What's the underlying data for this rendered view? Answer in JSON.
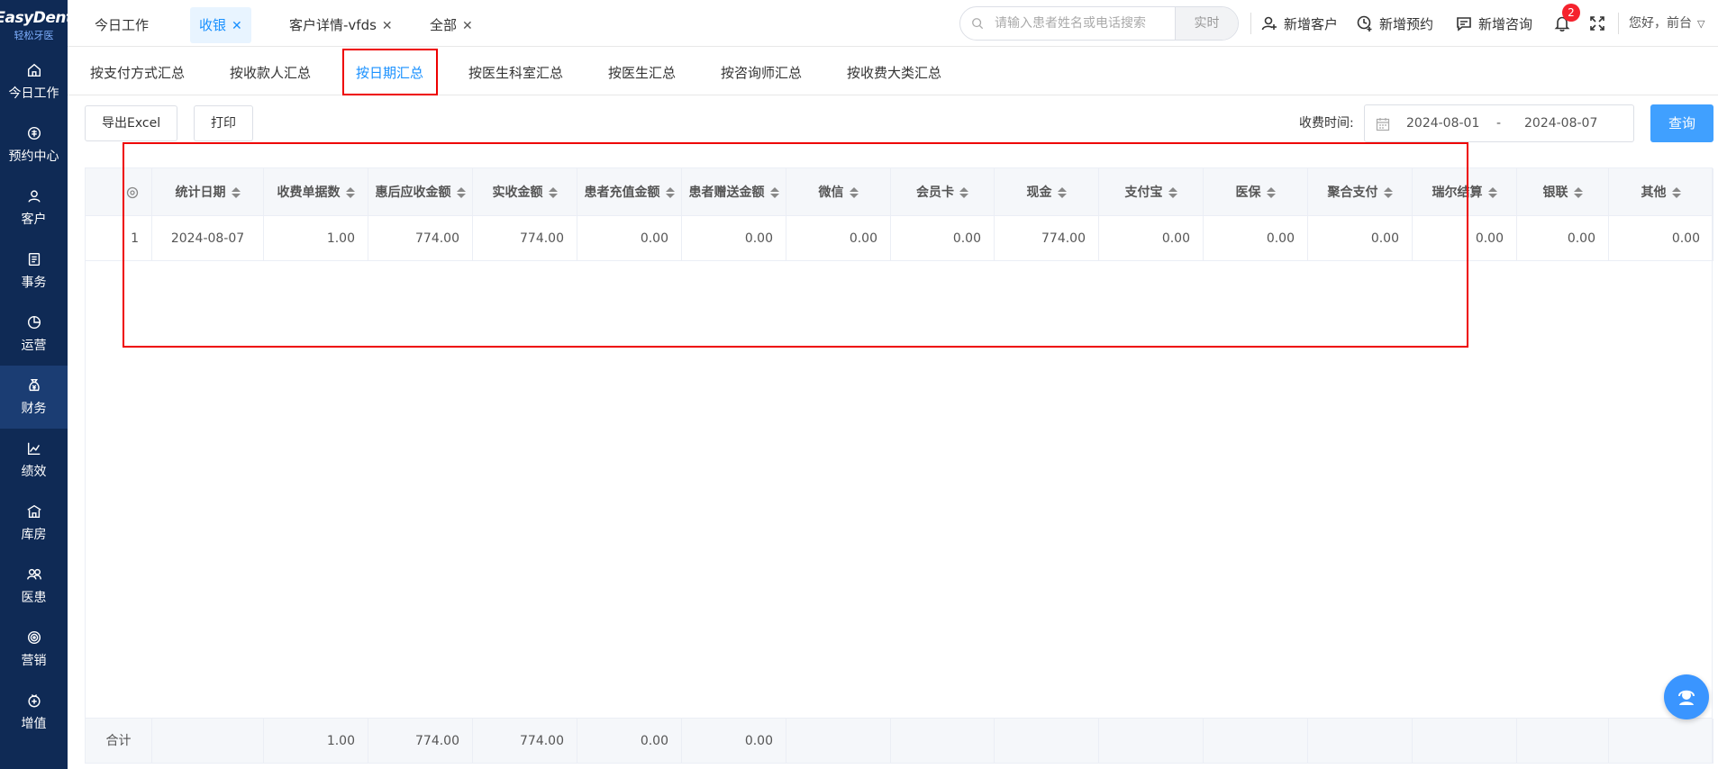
{
  "logo": {
    "line1": "EasyDent",
    "line2": "轻松牙医"
  },
  "sidebar": {
    "items": [
      {
        "label": "今日工作",
        "icon": "home-icon"
      },
      {
        "label": "预约中心",
        "icon": "calendar-icon"
      },
      {
        "label": "客户",
        "icon": "user-icon"
      },
      {
        "label": "事务",
        "icon": "task-icon"
      },
      {
        "label": "运营",
        "icon": "pie-chart-icon"
      },
      {
        "label": "财务",
        "icon": "money-bag-icon"
      },
      {
        "label": "绩效",
        "icon": "line-chart-icon"
      },
      {
        "label": "库房",
        "icon": "warehouse-icon"
      },
      {
        "label": "医患",
        "icon": "doctor-patient-icon"
      },
      {
        "label": "营销",
        "icon": "target-icon"
      },
      {
        "label": "增值",
        "icon": "value-added-icon"
      }
    ],
    "active": "财务"
  },
  "tabs": [
    {
      "label": "今日工作",
      "closable": false
    },
    {
      "label": "收银",
      "closable": true
    },
    {
      "label": "客户详情-vfds",
      "closable": true
    },
    {
      "label": "全部",
      "closable": true
    }
  ],
  "search": {
    "placeholder": "请输入患者姓名或电话搜索",
    "mode": "实时"
  },
  "actions": {
    "new_customer": "新增客户",
    "new_appointment": "新增预约",
    "new_consult": "新增咨询"
  },
  "notifications": {
    "count": "2"
  },
  "greeting": "您好，前台",
  "subtabs": [
    "按支付方式汇总",
    "按收款人汇总",
    "按日期汇总",
    "按医生科室汇总",
    "按医生汇总",
    "按咨询师汇总",
    "按收费大类汇总"
  ],
  "subtab_active": "按日期汇总",
  "toolbar": {
    "export": "导出Excel",
    "print": "打印",
    "date_label": "收费时间:",
    "date_from": "2024-08-01",
    "date_sep": "-",
    "date_to": "2024-08-07",
    "query": "查询"
  },
  "table": {
    "columns": [
      "统计日期",
      "收费单据数",
      "惠后应收金额",
      "实收金额",
      "患者充值金额",
      "患者赠送金额",
      "微信",
      "会员卡",
      "现金",
      "支付宝",
      "医保",
      "聚合支付",
      "瑞尔结算",
      "银联",
      "其他"
    ],
    "rows": [
      {
        "index": "1",
        "cells": [
          "2024-08-07",
          "1.00",
          "774.00",
          "774.00",
          "0.00",
          "0.00",
          "0.00",
          "0.00",
          "774.00",
          "0.00",
          "0.00",
          "0.00",
          "0.00",
          "0.00",
          "0.00"
        ]
      }
    ],
    "footer": {
      "label": "合计",
      "cells": [
        "",
        "1.00",
        "774.00",
        "774.00",
        "0.00",
        "0.00",
        "",
        "",
        "",
        "",
        "",
        "",
        "",
        "",
        ""
      ]
    }
  },
  "colors": {
    "sidebar": "#0f2a55",
    "accent": "#1890ff",
    "annotation": "#ee0000"
  }
}
